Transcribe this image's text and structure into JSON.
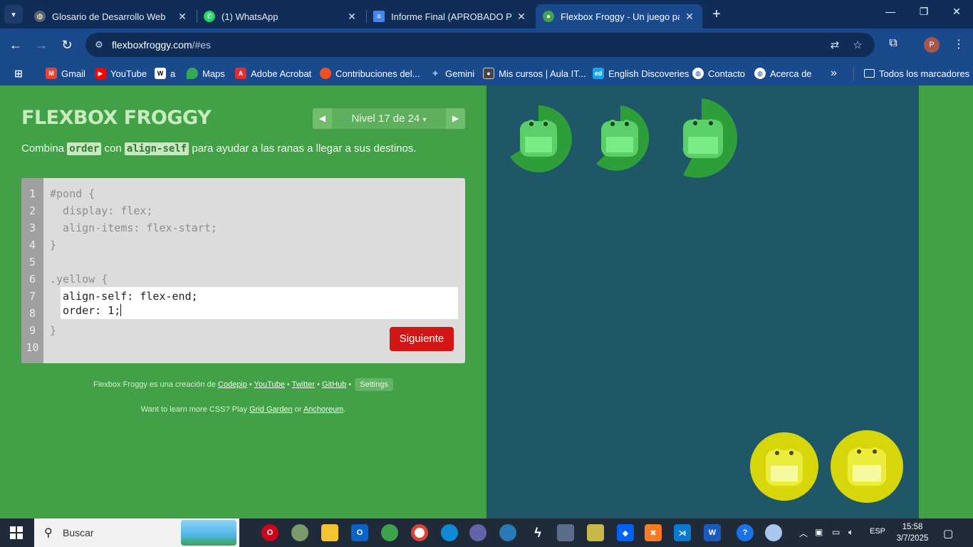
{
  "browser": {
    "tabs": [
      {
        "title": "Glosario de Desarrollo Web",
        "icon": "globe-icon",
        "color": "#5f6368"
      },
      {
        "title": "(1) WhatsApp",
        "icon": "whatsapp-icon",
        "color": "#25d366"
      },
      {
        "title": "Informe Final (APROBADO PARA",
        "icon": "docs-icon",
        "color": "#4285f4"
      },
      {
        "title": "Flexbox Froggy - Un juego para",
        "icon": "frog-icon",
        "color": "#3fa34d"
      }
    ],
    "address": {
      "domain": "flexboxfroggy.com",
      "path": "/#es"
    },
    "profile_initial": "P",
    "bookmarks": [
      {
        "label": "Gmail",
        "icon": "gmail-icon",
        "color": "#ea4335"
      },
      {
        "label": "YouTube",
        "icon": "youtube-icon",
        "color": "#ff0000"
      },
      {
        "label": "a",
        "icon": "wikipedia-icon",
        "color": "#ffffff"
      },
      {
        "label": "Maps",
        "icon": "maps-icon",
        "color": "#34a853"
      },
      {
        "label": "Adobe Acrobat",
        "icon": "acrobat-icon",
        "color": "#e02f2f"
      },
      {
        "label": "Contribuciones del...",
        "icon": "contrib-icon",
        "color": "#f25022"
      },
      {
        "label": "Gemini",
        "icon": "gemini-icon",
        "color": "#8ab4f8"
      },
      {
        "label": "Mis cursos | Aula IT...",
        "icon": "aula-icon",
        "color": "#444444"
      },
      {
        "label": "English Discoveries",
        "icon": "ed-icon",
        "color": "#1aa3e8"
      },
      {
        "label": "Contacto",
        "icon": "globe-icon",
        "color": "#ffffff"
      },
      {
        "label": "Acerca de",
        "icon": "globe-icon",
        "color": "#ffffff"
      }
    ],
    "bookmarks_overflow": "»",
    "all_bookmarks": "Todos los marcadores"
  },
  "game": {
    "logo": "FLEXBOX FROGGY",
    "level_label": "Nivel 17 de 24",
    "instructions": {
      "part1": "Combina ",
      "code1": "order",
      "part2": " con ",
      "code2": "align-self",
      "part3": " para ayudar a las ranas a llegar a sus destinos."
    },
    "line_numbers": [
      "1",
      "2",
      "3",
      "4",
      "5",
      "6",
      "7",
      "8",
      "9",
      "10"
    ],
    "code_before": [
      "#pond {",
      "  display: flex;",
      "  align-items: flex-start;",
      "}",
      "",
      ".yellow {"
    ],
    "user_input": [
      "align-self: flex-end;",
      "order: 1;"
    ],
    "code_after": [
      "}"
    ],
    "next_button": "Siguiente",
    "credits": {
      "prefix": "Flexbox Froggy es una creación de ",
      "codepip": "Codepip",
      "youtube": "YouTube",
      "twitter": "Twitter",
      "github": "GitHub",
      "sep": " • ",
      "settings": "Settings"
    },
    "learn_more": {
      "prefix": "Want to learn more CSS? Play ",
      "grid_garden": "Grid Garden",
      "or": " or ",
      "anchoreum": "Anchoreum",
      "suffix": "."
    },
    "colors": {
      "page_green": "#42a047",
      "pond": "#1f5768",
      "green_lily": "#2e9e3a",
      "green_frog": "#6ee07a",
      "yellow_lily": "#d6d60a",
      "yellow_frog": "#f5f56a",
      "button_red": "#d21515"
    }
  },
  "taskbar": {
    "search_placeholder": "Buscar",
    "language": "ESP",
    "time": "15:58",
    "date": "3/7/2025"
  }
}
